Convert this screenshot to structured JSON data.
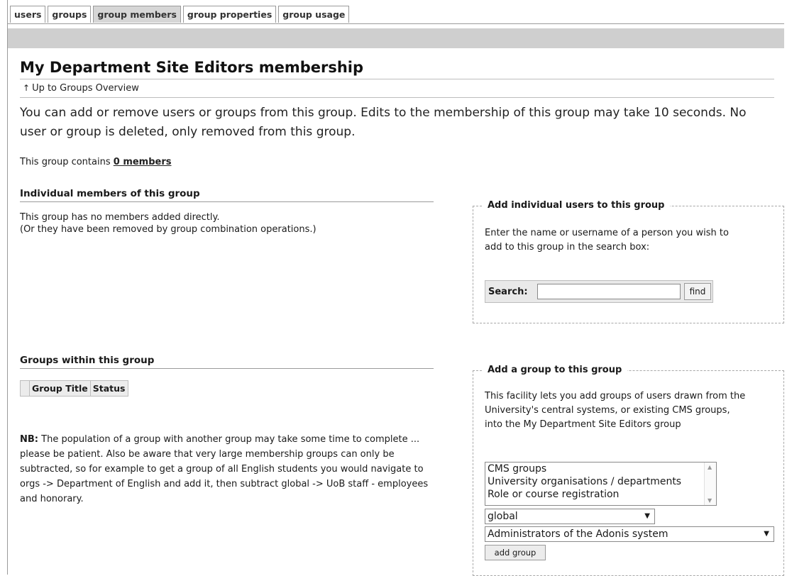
{
  "tabs": [
    {
      "label": "users"
    },
    {
      "label": "groups"
    },
    {
      "label": "group members"
    },
    {
      "label": "group properties"
    },
    {
      "label": "group usage"
    }
  ],
  "page": {
    "title": "My Department Site Editors membership",
    "up_link": "Up to Groups Overview",
    "intro": "You can add or remove users or groups from this group. Edits to the membership of this group may take 10 seconds. No user or group is deleted, only removed from this group.",
    "contains_prefix": "This group contains ",
    "contains_link": "0 members"
  },
  "individual": {
    "heading": "Individual members of this group",
    "line1": "This group has no members added directly.",
    "line2": "(Or they have been removed by group combination operations.)"
  },
  "subgroups": {
    "heading": "Groups within this group",
    "columns": [
      "Group Title",
      "Status"
    ],
    "nb_label": "NB:",
    "nb_text": " The population of a group with another group may take some time to complete ... please be patient. Also be aware that very large membership groups can only be subtracted, so for example to get a group of all English students you would navigate to orgs -> Department of English and add it, then subtract global -> UoB staff - employees and honorary."
  },
  "add_users": {
    "legend": "Add individual users to this group",
    "text": "Enter the name or username of a person you wish to add to this group in the search box:",
    "search_label": "Search:",
    "search_value": "",
    "find_label": "find"
  },
  "add_group": {
    "legend": "Add a group to this group",
    "text": "This facility lets you add groups of users drawn from the University's central systems, or existing CMS groups, into the My Department Site Editors group",
    "list_options": [
      "CMS groups",
      "University organisations / departments",
      "Role or course registration"
    ],
    "select1": "global",
    "select2": "Administrators of the Adonis system",
    "button": "add group"
  }
}
